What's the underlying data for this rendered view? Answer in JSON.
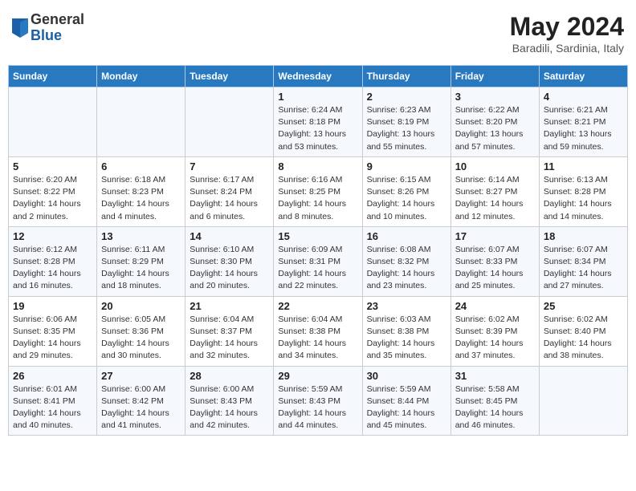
{
  "header": {
    "logo_general": "General",
    "logo_blue": "Blue",
    "title": "May 2024",
    "location": "Baradili, Sardinia, Italy"
  },
  "columns": [
    "Sunday",
    "Monday",
    "Tuesday",
    "Wednesday",
    "Thursday",
    "Friday",
    "Saturday"
  ],
  "weeks": [
    [
      {
        "day": "",
        "sunrise": "",
        "sunset": "",
        "daylight": ""
      },
      {
        "day": "",
        "sunrise": "",
        "sunset": "",
        "daylight": ""
      },
      {
        "day": "",
        "sunrise": "",
        "sunset": "",
        "daylight": ""
      },
      {
        "day": "1",
        "sunrise": "Sunrise: 6:24 AM",
        "sunset": "Sunset: 8:18 PM",
        "daylight": "Daylight: 13 hours and 53 minutes."
      },
      {
        "day": "2",
        "sunrise": "Sunrise: 6:23 AM",
        "sunset": "Sunset: 8:19 PM",
        "daylight": "Daylight: 13 hours and 55 minutes."
      },
      {
        "day": "3",
        "sunrise": "Sunrise: 6:22 AM",
        "sunset": "Sunset: 8:20 PM",
        "daylight": "Daylight: 13 hours and 57 minutes."
      },
      {
        "day": "4",
        "sunrise": "Sunrise: 6:21 AM",
        "sunset": "Sunset: 8:21 PM",
        "daylight": "Daylight: 13 hours and 59 minutes."
      }
    ],
    [
      {
        "day": "5",
        "sunrise": "Sunrise: 6:20 AM",
        "sunset": "Sunset: 8:22 PM",
        "daylight": "Daylight: 14 hours and 2 minutes."
      },
      {
        "day": "6",
        "sunrise": "Sunrise: 6:18 AM",
        "sunset": "Sunset: 8:23 PM",
        "daylight": "Daylight: 14 hours and 4 minutes."
      },
      {
        "day": "7",
        "sunrise": "Sunrise: 6:17 AM",
        "sunset": "Sunset: 8:24 PM",
        "daylight": "Daylight: 14 hours and 6 minutes."
      },
      {
        "day": "8",
        "sunrise": "Sunrise: 6:16 AM",
        "sunset": "Sunset: 8:25 PM",
        "daylight": "Daylight: 14 hours and 8 minutes."
      },
      {
        "day": "9",
        "sunrise": "Sunrise: 6:15 AM",
        "sunset": "Sunset: 8:26 PM",
        "daylight": "Daylight: 14 hours and 10 minutes."
      },
      {
        "day": "10",
        "sunrise": "Sunrise: 6:14 AM",
        "sunset": "Sunset: 8:27 PM",
        "daylight": "Daylight: 14 hours and 12 minutes."
      },
      {
        "day": "11",
        "sunrise": "Sunrise: 6:13 AM",
        "sunset": "Sunset: 8:28 PM",
        "daylight": "Daylight: 14 hours and 14 minutes."
      }
    ],
    [
      {
        "day": "12",
        "sunrise": "Sunrise: 6:12 AM",
        "sunset": "Sunset: 8:28 PM",
        "daylight": "Daylight: 14 hours and 16 minutes."
      },
      {
        "day": "13",
        "sunrise": "Sunrise: 6:11 AM",
        "sunset": "Sunset: 8:29 PM",
        "daylight": "Daylight: 14 hours and 18 minutes."
      },
      {
        "day": "14",
        "sunrise": "Sunrise: 6:10 AM",
        "sunset": "Sunset: 8:30 PM",
        "daylight": "Daylight: 14 hours and 20 minutes."
      },
      {
        "day": "15",
        "sunrise": "Sunrise: 6:09 AM",
        "sunset": "Sunset: 8:31 PM",
        "daylight": "Daylight: 14 hours and 22 minutes."
      },
      {
        "day": "16",
        "sunrise": "Sunrise: 6:08 AM",
        "sunset": "Sunset: 8:32 PM",
        "daylight": "Daylight: 14 hours and 23 minutes."
      },
      {
        "day": "17",
        "sunrise": "Sunrise: 6:07 AM",
        "sunset": "Sunset: 8:33 PM",
        "daylight": "Daylight: 14 hours and 25 minutes."
      },
      {
        "day": "18",
        "sunrise": "Sunrise: 6:07 AM",
        "sunset": "Sunset: 8:34 PM",
        "daylight": "Daylight: 14 hours and 27 minutes."
      }
    ],
    [
      {
        "day": "19",
        "sunrise": "Sunrise: 6:06 AM",
        "sunset": "Sunset: 8:35 PM",
        "daylight": "Daylight: 14 hours and 29 minutes."
      },
      {
        "day": "20",
        "sunrise": "Sunrise: 6:05 AM",
        "sunset": "Sunset: 8:36 PM",
        "daylight": "Daylight: 14 hours and 30 minutes."
      },
      {
        "day": "21",
        "sunrise": "Sunrise: 6:04 AM",
        "sunset": "Sunset: 8:37 PM",
        "daylight": "Daylight: 14 hours and 32 minutes."
      },
      {
        "day": "22",
        "sunrise": "Sunrise: 6:04 AM",
        "sunset": "Sunset: 8:38 PM",
        "daylight": "Daylight: 14 hours and 34 minutes."
      },
      {
        "day": "23",
        "sunrise": "Sunrise: 6:03 AM",
        "sunset": "Sunset: 8:38 PM",
        "daylight": "Daylight: 14 hours and 35 minutes."
      },
      {
        "day": "24",
        "sunrise": "Sunrise: 6:02 AM",
        "sunset": "Sunset: 8:39 PM",
        "daylight": "Daylight: 14 hours and 37 minutes."
      },
      {
        "day": "25",
        "sunrise": "Sunrise: 6:02 AM",
        "sunset": "Sunset: 8:40 PM",
        "daylight": "Daylight: 14 hours and 38 minutes."
      }
    ],
    [
      {
        "day": "26",
        "sunrise": "Sunrise: 6:01 AM",
        "sunset": "Sunset: 8:41 PM",
        "daylight": "Daylight: 14 hours and 40 minutes."
      },
      {
        "day": "27",
        "sunrise": "Sunrise: 6:00 AM",
        "sunset": "Sunset: 8:42 PM",
        "daylight": "Daylight: 14 hours and 41 minutes."
      },
      {
        "day": "28",
        "sunrise": "Sunrise: 6:00 AM",
        "sunset": "Sunset: 8:43 PM",
        "daylight": "Daylight: 14 hours and 42 minutes."
      },
      {
        "day": "29",
        "sunrise": "Sunrise: 5:59 AM",
        "sunset": "Sunset: 8:43 PM",
        "daylight": "Daylight: 14 hours and 44 minutes."
      },
      {
        "day": "30",
        "sunrise": "Sunrise: 5:59 AM",
        "sunset": "Sunset: 8:44 PM",
        "daylight": "Daylight: 14 hours and 45 minutes."
      },
      {
        "day": "31",
        "sunrise": "Sunrise: 5:58 AM",
        "sunset": "Sunset: 8:45 PM",
        "daylight": "Daylight: 14 hours and 46 minutes."
      },
      {
        "day": "",
        "sunrise": "",
        "sunset": "",
        "daylight": ""
      }
    ]
  ]
}
